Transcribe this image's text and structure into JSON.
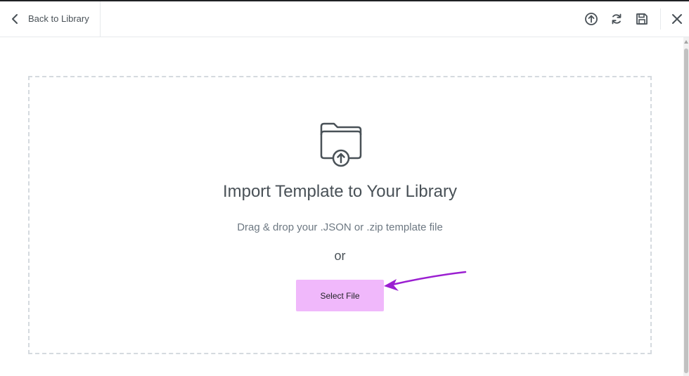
{
  "header": {
    "back_label": "Back to Library",
    "tools": [
      {
        "name": "export-icon"
      },
      {
        "name": "sync-icon"
      },
      {
        "name": "save-icon"
      },
      {
        "name": "close-icon"
      }
    ]
  },
  "import": {
    "title": "Import Template to Your Library",
    "subtitle": "Drag & drop your .JSON or .zip template file",
    "or_label": "or",
    "select_label": "Select File"
  },
  "colors": {
    "select_button_bg": "#f0b8fb",
    "annotation_arrow": "#9b1fd1",
    "text": "#495157",
    "dashed_border": "#d5dadf"
  }
}
